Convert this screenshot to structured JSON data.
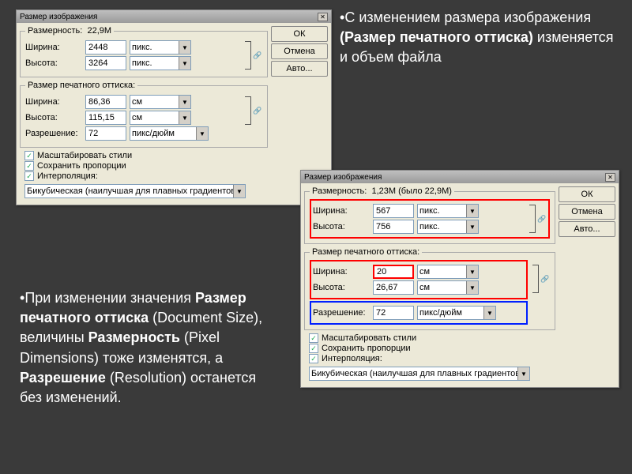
{
  "annotations": {
    "top": {
      "pre": "С изменением размера изображения ",
      "bold": "(Размер печатного оттиска)",
      "post": " изменяется и объем файла"
    },
    "bottom": {
      "l1": "При изменении значения ",
      "b1": "Размер печатного оттиска",
      "l2": "(Document Size), величины ",
      "b2": "Размерность ",
      "l3": "(Pixel Dimensions) тоже изменятся, а ",
      "b3": "Разрешение ",
      "l4": "(Resolution) останется без изменений."
    }
  },
  "dlg1": {
    "title": "Размер изображения",
    "buttons": {
      "ok": "ОК",
      "cancel": "Отмена",
      "auto": "Авто..."
    },
    "dimensions": {
      "legend": "Размерность:",
      "size": "22,9M",
      "width_lbl": "Ширина:",
      "width_val": "2448",
      "width_unit": "пикс.",
      "height_lbl": "Высота:",
      "height_val": "3264",
      "height_unit": "пикс."
    },
    "print": {
      "legend": "Размер печатного оттиска:",
      "width_lbl": "Ширина:",
      "width_val": "86,36",
      "width_unit": "см",
      "height_lbl": "Высота:",
      "height_val": "115,15",
      "height_unit": "см",
      "res_lbl": "Разрешение:",
      "res_val": "72",
      "res_unit": "пикс/дюйм"
    },
    "checks": {
      "scale": "Масштабировать стили",
      "constrain": "Сохранить пропорции",
      "interp": "Интерполяция:"
    },
    "method": "Бикубическая (наилучшая для плавных градиентов)"
  },
  "dlg2": {
    "title": "Размер изображения",
    "buttons": {
      "ok": "ОК",
      "cancel": "Отмена",
      "auto": "Авто..."
    },
    "dimensions": {
      "legend": "Размерность:",
      "size": "1,23M (было 22,9M)",
      "width_lbl": "Ширина:",
      "width_val": "567",
      "width_unit": "пикс.",
      "height_lbl": "Высота:",
      "height_val": "756",
      "height_unit": "пикс."
    },
    "print": {
      "legend": "Размер печатного оттиска:",
      "width_lbl": "Ширина:",
      "width_val": "20",
      "width_unit": "см",
      "height_lbl": "Высота:",
      "height_val": "26,67",
      "height_unit": "см",
      "res_lbl": "Разрешение:",
      "res_val": "72",
      "res_unit": "пикс/дюйм"
    },
    "checks": {
      "scale": "Масштабировать стили",
      "constrain": "Сохранить пропорции",
      "interp": "Интерполяция:"
    },
    "method": "Бикубическая (наилучшая для плавных градиентов)"
  }
}
